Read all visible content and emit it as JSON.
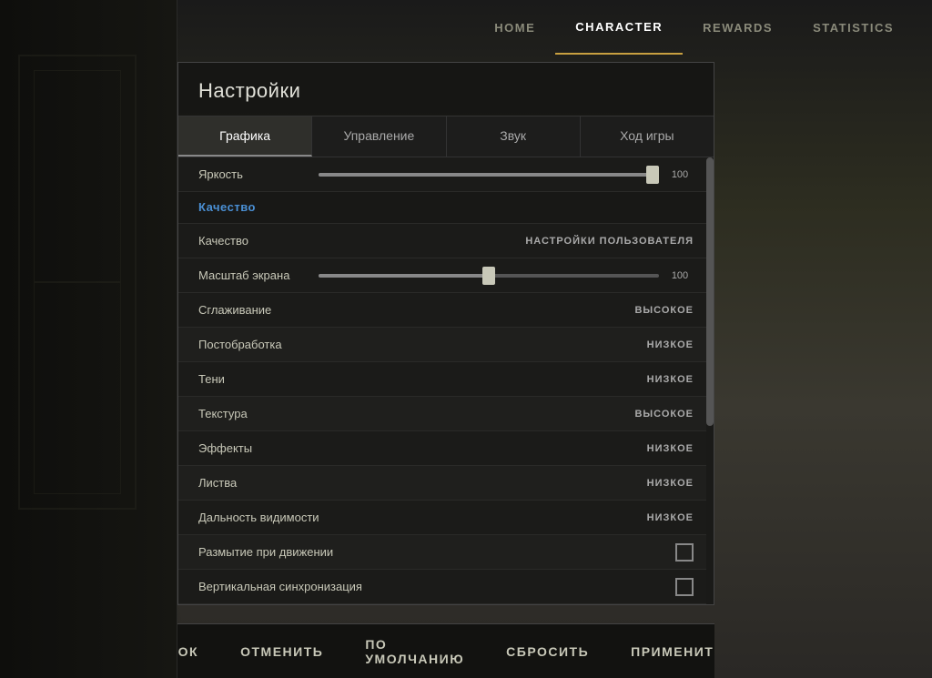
{
  "nav": {
    "items": [
      {
        "id": "home",
        "label": "HOME",
        "active": false
      },
      {
        "id": "character",
        "label": "CHARACTER",
        "active": false
      },
      {
        "id": "rewards",
        "label": "REWARDS",
        "active": false
      },
      {
        "id": "statistics",
        "label": "STATISTICS",
        "active": false
      }
    ]
  },
  "panel": {
    "title": "Настройки",
    "tabs": [
      {
        "id": "graphics",
        "label": "Графика",
        "active": true
      },
      {
        "id": "controls",
        "label": "Управление",
        "active": false
      },
      {
        "id": "sound",
        "label": "Звук",
        "active": false
      },
      {
        "id": "gameplay",
        "label": "Ход игры",
        "active": false
      }
    ],
    "brightness": {
      "label": "Яркость",
      "value": "100"
    },
    "quality_section": {
      "label": "Качество"
    },
    "settings": [
      {
        "id": "quality",
        "label": "Качество",
        "value": "НАСТРОЙКИ ПОЛЬЗОВАТЕЛЯ"
      },
      {
        "id": "screen_scale",
        "label": "Масштаб экрана",
        "value": "100",
        "type": "slider"
      },
      {
        "id": "antialiasing",
        "label": "Сглаживание",
        "value": "ВЫСОКОЕ"
      },
      {
        "id": "postprocessing",
        "label": "Постобработка",
        "value": "НИЗКОЕ"
      },
      {
        "id": "shadows",
        "label": "Тени",
        "value": "НИЗКОЕ"
      },
      {
        "id": "textures",
        "label": "Текстура",
        "value": "ВЫСОКОЕ"
      },
      {
        "id": "effects",
        "label": "Эффекты",
        "value": "НИЗКОЕ"
      },
      {
        "id": "foliage",
        "label": "Листва",
        "value": "НИЗКОЕ"
      },
      {
        "id": "view_distance",
        "label": "Дальность видимости",
        "value": "НИЗКОЕ"
      },
      {
        "id": "motion_blur",
        "label": "Размытие при движении",
        "value": "",
        "type": "checkbox"
      },
      {
        "id": "vsync",
        "label": "Вертикальная синхронизация",
        "value": "",
        "type": "checkbox"
      }
    ]
  },
  "bottom_bar": {
    "buttons": [
      {
        "id": "ok",
        "label": "ОК"
      },
      {
        "id": "cancel",
        "label": "ОТМЕНИТЬ"
      },
      {
        "id": "default",
        "label": "ПО УМОЛЧАНИЮ"
      },
      {
        "id": "reset",
        "label": "СБРОСИТЬ"
      },
      {
        "id": "apply",
        "label": "ПРИМЕНИТ"
      }
    ]
  }
}
